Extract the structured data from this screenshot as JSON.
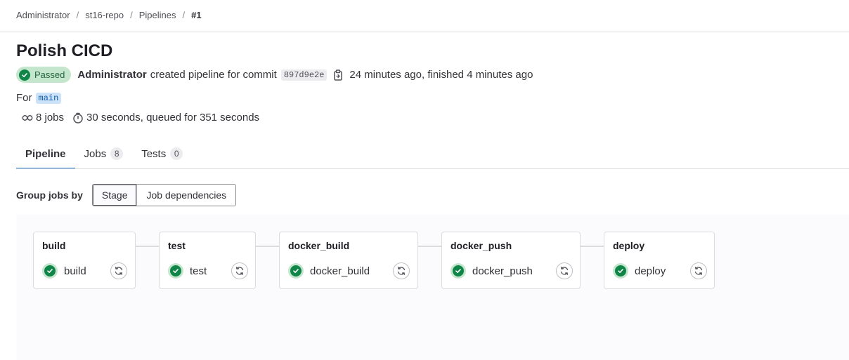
{
  "breadcrumb": {
    "items": [
      "Administrator",
      "st16-repo",
      "Pipelines"
    ],
    "current": "#1",
    "separator": "/"
  },
  "pipeline": {
    "title": "Polish CICD",
    "status": "Passed",
    "author": "Administrator",
    "created_text": "created pipeline for commit",
    "commit_sha": "897d9e2e",
    "time_text": "24 minutes ago, finished 4 minutes ago",
    "for_label": "For",
    "ref": "main",
    "jobs_count_text": "8 jobs",
    "duration_text": "30 seconds, queued for 351 seconds"
  },
  "tabs": [
    {
      "label": "Pipeline",
      "count": null,
      "active": true
    },
    {
      "label": "Jobs",
      "count": "8",
      "active": false
    },
    {
      "label": "Tests",
      "count": "0",
      "active": false
    }
  ],
  "group_by": {
    "label": "Group jobs by",
    "options": [
      "Stage",
      "Job dependencies"
    ],
    "selected": "Stage"
  },
  "stages": [
    {
      "name": "build",
      "job": "build",
      "status": "success"
    },
    {
      "name": "test",
      "job": "test",
      "status": "success"
    },
    {
      "name": "docker_build",
      "job": "docker_build",
      "status": "success"
    },
    {
      "name": "docker_push",
      "job": "docker_push",
      "status": "success"
    },
    {
      "name": "deploy",
      "job": "deploy",
      "status": "success"
    }
  ],
  "colors": {
    "success": "#108548",
    "success_bg": "#c3e6cd",
    "active_tab": "#1f75cb",
    "ref_bg": "#cbe2f9"
  },
  "icons": {
    "status": "check-circle-icon",
    "copy": "clipboard-icon",
    "jobs": "pipeline-link-icon",
    "duration": "timer-icon",
    "retry": "retry-icon"
  }
}
